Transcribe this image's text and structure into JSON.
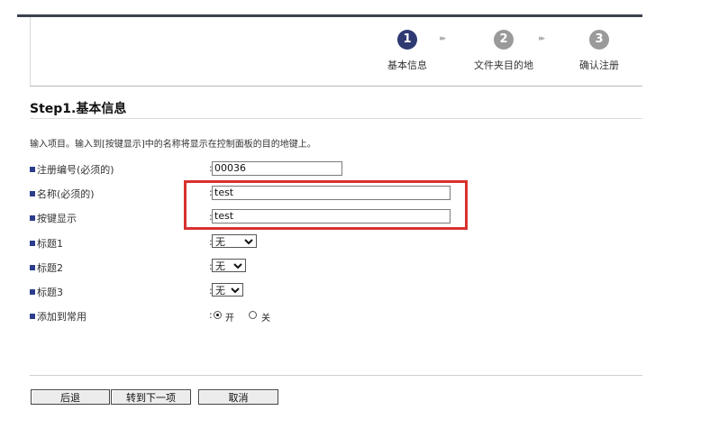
{
  "steps": [
    {
      "number": "1",
      "label": "基本信息"
    },
    {
      "number": "2",
      "label": "文件夹目的地"
    },
    {
      "number": "3",
      "label": "确认注册"
    }
  ],
  "arrow_glyph": "▸▸",
  "page_title": "Step1.基本信息",
  "description": "输入项目。输入到[按键显示]中的名称将显示在控制面板的目的地键上。",
  "fields": {
    "reg_no": {
      "label": "注册编号(必须的)",
      "value": "00036"
    },
    "name": {
      "label": "名称(必须的)",
      "value": "test"
    },
    "key_display": {
      "label": "按键显示",
      "value": "test"
    },
    "title1": {
      "label": "标题1",
      "value": "无"
    },
    "title2": {
      "label": "标题2",
      "value": "无"
    },
    "title3": {
      "label": "标题3",
      "value": "无"
    },
    "add_frequent": {
      "label": "添加到常用",
      "on_label": "开",
      "off_label": "关",
      "selected": "on"
    }
  },
  "colon": ":",
  "buttons": {
    "back": "后退",
    "next": "转到下一项",
    "cancel": "取消"
  },
  "colors": {
    "accent": "#2f3a72",
    "highlight_box": "#d8312f",
    "inactive_step": "#9a9a9a"
  }
}
